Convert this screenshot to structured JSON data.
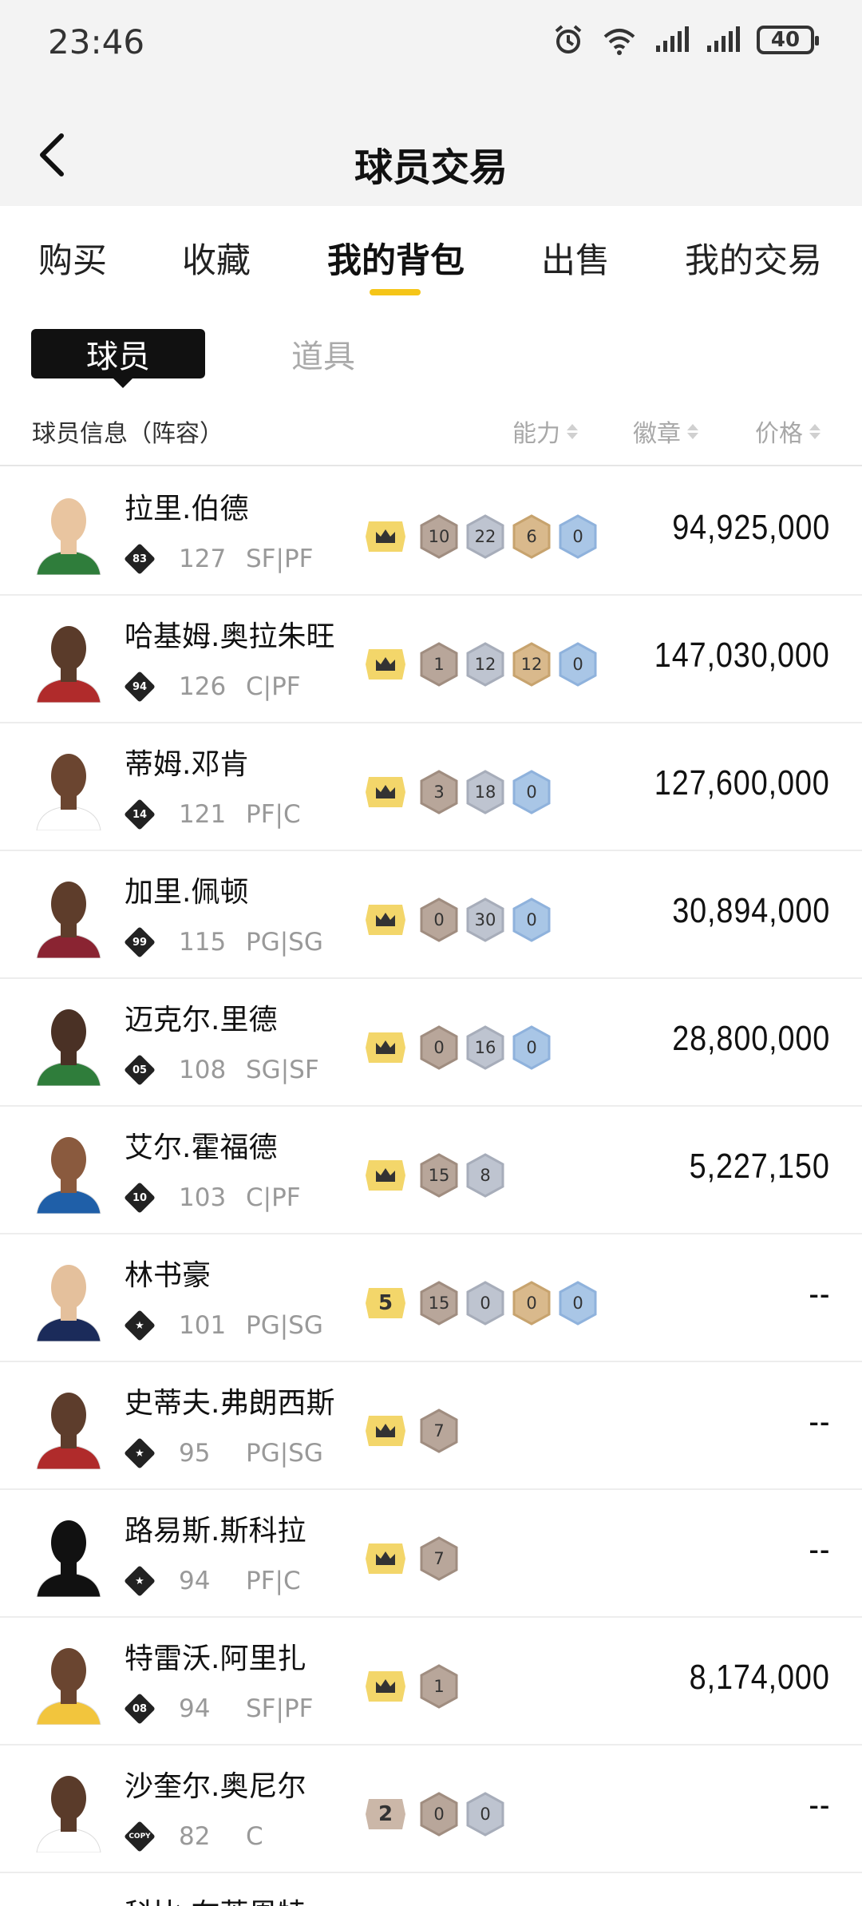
{
  "status_bar": {
    "time": "23:46",
    "battery": "40",
    "network": "6"
  },
  "header": {
    "title": "球员交易"
  },
  "tabs": [
    {
      "label": "购买"
    },
    {
      "label": "收藏"
    },
    {
      "label": "我的背包",
      "active": true
    },
    {
      "label": "出售"
    },
    {
      "label": "我的交易"
    }
  ],
  "segments": {
    "active": "球员",
    "other": "道具"
  },
  "columns": {
    "info": "球员信息（阵容）",
    "ability": "能力",
    "badge": "徽章",
    "price": "价格"
  },
  "colors": {
    "accent": "#f5c518",
    "gold": "#f3d66a",
    "bronze_hex": "#b8a69a",
    "silver_hex": "#bec4d0",
    "gold_hex": "#d9b98c",
    "blue_hex": "#a9c6e6"
  },
  "players": [
    {
      "name": "拉里.伯德",
      "card": "83",
      "ovr": "127",
      "pos": "SF|PF",
      "level": "crown",
      "badges": [
        "10",
        "22",
        "6",
        "0"
      ],
      "price": "94,925,000"
    },
    {
      "name": "哈基姆.奥拉朱旺",
      "card": "94",
      "ovr": "126",
      "pos": "C|PF",
      "level": "crown",
      "badges": [
        "1",
        "12",
        "12",
        "0"
      ],
      "price": "147,030,000"
    },
    {
      "name": "蒂姆.邓肯",
      "card": "14",
      "ovr": "121",
      "pos": "PF|C",
      "level": "crown",
      "badges": [
        "3",
        "18",
        "0"
      ],
      "price": "127,600,000"
    },
    {
      "name": "加里.佩顿",
      "card": "99",
      "ovr": "115",
      "pos": "PG|SG",
      "level": "crown",
      "badges": [
        "0",
        "30",
        "0"
      ],
      "price": "30,894,000"
    },
    {
      "name": "迈克尔.里德",
      "card": "05",
      "ovr": "108",
      "pos": "SG|SF",
      "level": "crown",
      "badges": [
        "0",
        "16",
        "0"
      ],
      "price": "28,800,000"
    },
    {
      "name": "艾尔.霍福德",
      "card": "10",
      "ovr": "103",
      "pos": "C|PF",
      "level": "crown",
      "badges": [
        "15",
        "8"
      ],
      "price": "5,227,150"
    },
    {
      "name": "林书豪",
      "card": "★",
      "ovr": "101",
      "pos": "PG|SG",
      "level": "5",
      "badges": [
        "15",
        "0",
        "0",
        "0"
      ],
      "price": "--"
    },
    {
      "name": "史蒂夫.弗朗西斯",
      "card": "★",
      "ovr": "95",
      "pos": "PG|SG",
      "level": "crown",
      "badges": [
        "7"
      ],
      "price": "--"
    },
    {
      "name": "路易斯.斯科拉",
      "card": "★",
      "ovr": "94",
      "pos": "PF|C",
      "level": "crown",
      "badges": [
        "7"
      ],
      "price": "--"
    },
    {
      "name": "特雷沃.阿里扎",
      "card": "08",
      "ovr": "94",
      "pos": "SF|PF",
      "level": "crown",
      "badges": [
        "1"
      ],
      "price": "8,174,000"
    },
    {
      "name": "沙奎尔.奥尼尔",
      "card": "COPY",
      "ovr": "82",
      "pos": "C",
      "level": "2",
      "badges": [
        "0",
        "0"
      ],
      "price": "--"
    },
    {
      "name": "科比.布莱恩特"
    }
  ]
}
